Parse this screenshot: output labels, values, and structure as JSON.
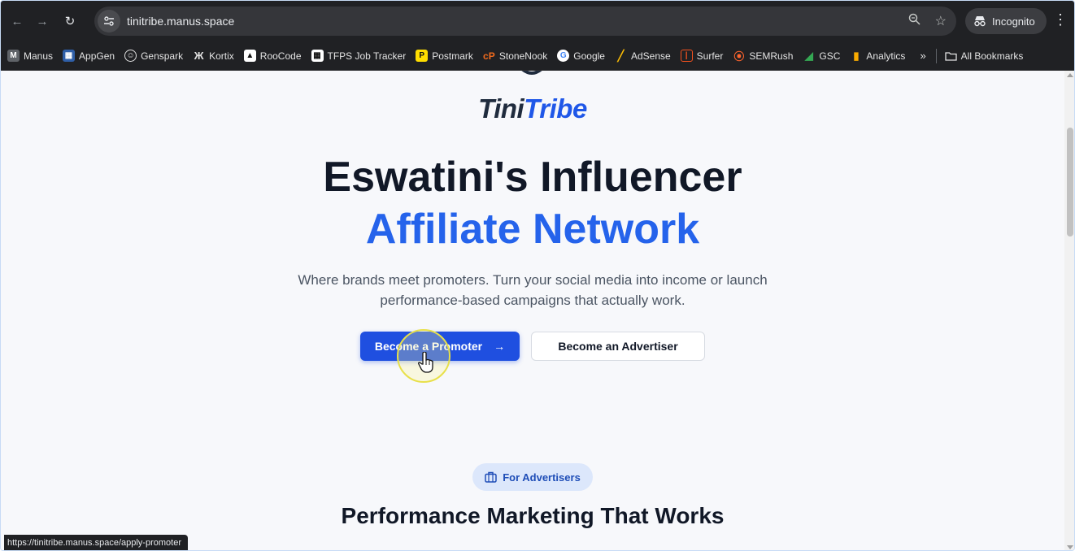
{
  "browser": {
    "url": "tinitribe.manus.space",
    "incognito_label": "Incognito",
    "status_url": "https://tinitribe.manus.space/apply-promoter"
  },
  "bookmarks": [
    {
      "label": "Manus",
      "icon": "manus-icon",
      "color": "#5f6368"
    },
    {
      "label": "AppGen",
      "icon": "appgen-icon",
      "color": "#4a90d9"
    },
    {
      "label": "Genspark",
      "icon": "genspark-icon",
      "color": "#e3e3e3"
    },
    {
      "label": "Kortix",
      "icon": "kortix-icon",
      "color": "#111111"
    },
    {
      "label": "RooCode",
      "icon": "roocode-icon",
      "color": "#ffffff"
    },
    {
      "label": "TFPS Job Tracker",
      "icon": "tfps-icon",
      "color": "#ffffff"
    },
    {
      "label": "Postmark",
      "icon": "postmark-icon",
      "color": "#ffde00"
    },
    {
      "label": "StoneNook",
      "icon": "stonenook-icon",
      "color": "#f06a1d"
    },
    {
      "label": "Google",
      "icon": "google-icon",
      "color": "#ffffff"
    },
    {
      "label": "AdSense",
      "icon": "adsense-icon",
      "color": "#fbbc04"
    },
    {
      "label": "Surfer",
      "icon": "surfer-icon",
      "color": "#f4511e"
    },
    {
      "label": "SEMRush",
      "icon": "semrush-icon",
      "color": "#ff642d"
    },
    {
      "label": "GSC",
      "icon": "gsc-icon",
      "color": "#34a853"
    },
    {
      "label": "Analytics",
      "icon": "analytics-icon",
      "color": "#f9ab00"
    }
  ],
  "bookmarks_more": "»",
  "all_bookmarks_label": "All Bookmarks",
  "site": {
    "brand_part1": "Tini",
    "brand_part2": "Tribe",
    "hero_title": "Eswatini's Influencer",
    "hero_accent": "Affiliate Network",
    "hero_desc": "Where brands meet promoters. Turn your social media into income or launch performance-based campaigns that actually work.",
    "primary_cta": "Become a Promoter",
    "secondary_cta": "Become an Advertiser",
    "badge": "For Advertisers",
    "section_title": "Performance Marketing That Works"
  },
  "colors": {
    "brand_blue": "#2563eb",
    "button_blue": "#1f4fe0",
    "dark_text": "#111827"
  }
}
